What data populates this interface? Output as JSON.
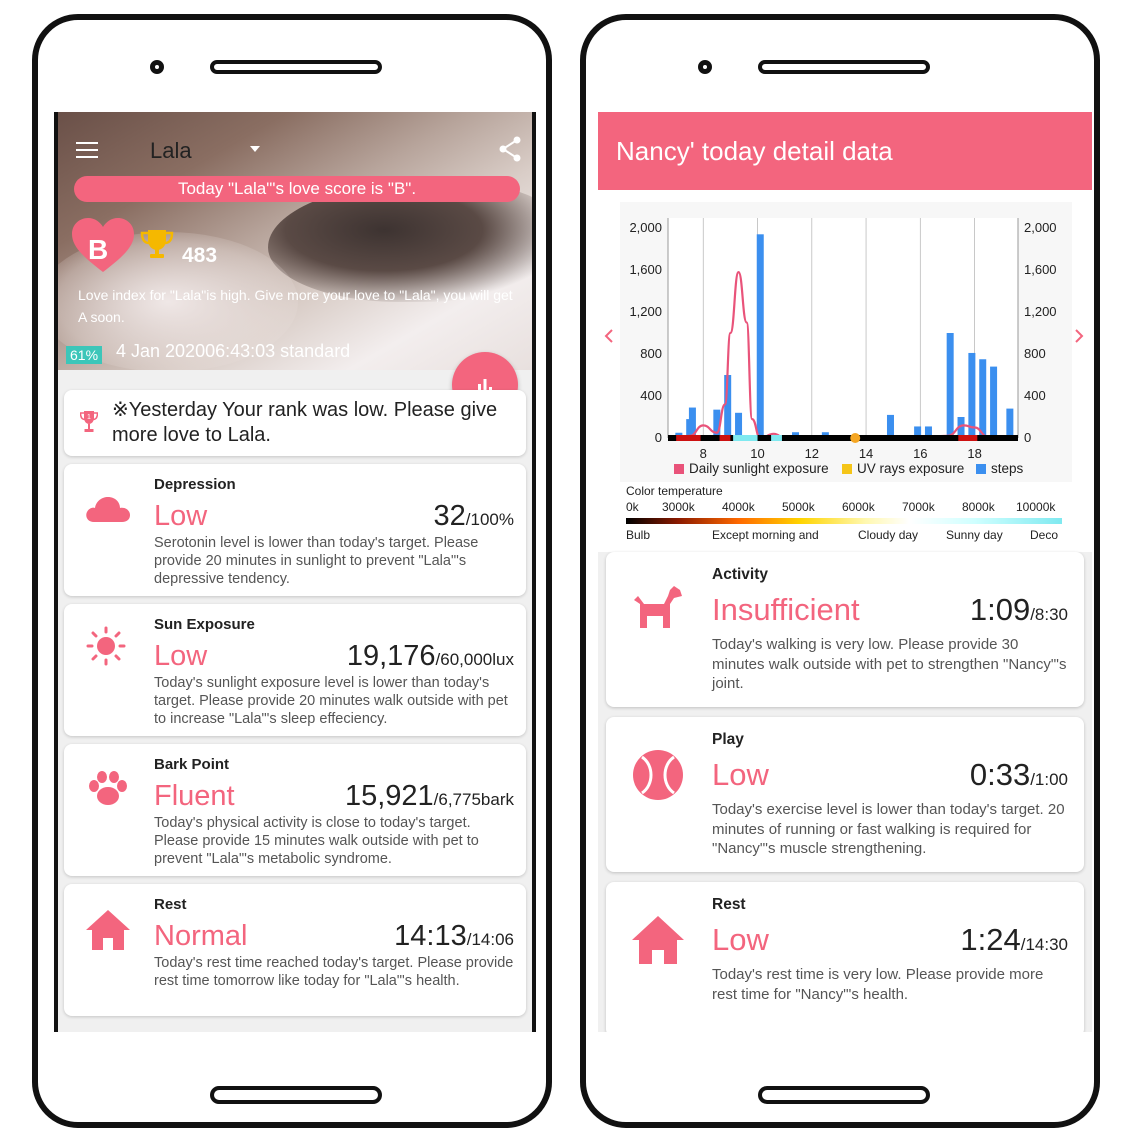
{
  "left": {
    "pet_name": "Lala",
    "score_banner": "Today \"Lala\"'s love score is \"B\".",
    "grade": "B",
    "points": "483",
    "love_message": "Love index for \"Lala\"is high. Give more your love to \"Lala\", you will get A soon.",
    "percent_badge": "61%",
    "timestamp": "4 Jan 202006:43:03 standard",
    "rank_message": "※Yesterday Your rank was low. Please give more love to Lala.",
    "cards": [
      {
        "title": "Depression",
        "level": "Low",
        "value": "32",
        "unit": "/100%",
        "desc": "Serotonin level is lower than today's target. Please provide 20 minutes in sunlight to prevent \"Lala\"'s depressive tendency.",
        "icon": "cloud-icon"
      },
      {
        "title": "Sun Exposure",
        "level": "Low",
        "value": "19,176",
        "unit": "/60,000lux",
        "desc": "Today's sunlight exposure level is lower than today's target. Please provide 20 minutes walk outside with pet to increase \"Lala\"'s sleep effeciency.",
        "icon": "sun-icon"
      },
      {
        "title": "Bark Point",
        "level": "Fluent",
        "value": "15,921",
        "unit": "/6,775bark",
        "desc": "Today's physical activity is close to today's target. Please provide 15 minutes walk outside with pet to prevent \"Lala\"'s metabolic syndrome.",
        "icon": "paw-icon"
      },
      {
        "title": "Rest",
        "level": "Normal",
        "value": "14:13",
        "unit": "/14:06",
        "desc": "Today's rest time reached today's target. Please provide rest time tomorrow like today for \"Lala\"'s health.",
        "icon": "home-icon"
      }
    ]
  },
  "right": {
    "title": "Nancy' today detail data",
    "color_temperature": {
      "title": "Color temperature",
      "scale": [
        "0k",
        "3000k",
        "4000k",
        "5000k",
        "6000k",
        "7000k",
        "8000k",
        "10000k"
      ],
      "labels": [
        "Bulb",
        "Except morning and",
        "Cloudy day",
        "Sunny day",
        "Deco"
      ]
    },
    "cards": [
      {
        "title": "Activity",
        "level": "Insufficient",
        "value": "1:09",
        "unit": "/8:30",
        "desc": "Today's walking is very low. Please provide 30 minutes walk outside with pet to strengthen \"Nancy\"'s joint.",
        "icon": "dog-icon"
      },
      {
        "title": "Play",
        "level": "Low",
        "value": "0:33",
        "unit": "/1:00",
        "desc": "Today's exercise level is lower than today's target. 20 minutes of running or fast walking is required for \"Nancy\"'s muscle strengthening.",
        "icon": "ball-icon"
      },
      {
        "title": "Rest",
        "level": "Low",
        "value": "1:24",
        "unit": "/14:30",
        "desc": "Today's rest time is very low. Please provide more rest time for \"Nancy\"'s health.",
        "icon": "home-icon"
      }
    ]
  },
  "chart_data": {
    "type": "bar",
    "x_ticks": [
      "8",
      "10",
      "12",
      "14",
      "16",
      "18"
    ],
    "xlim": [
      6.7,
      19.6
    ],
    "ylim": [
      0,
      2000
    ],
    "y_ticks_left": [
      "2,000",
      "1,600",
      "1,200",
      "800",
      "400",
      "0"
    ],
    "y_ticks_right": [
      "2,000",
      "1,600",
      "1,200",
      "800",
      "400",
      "0"
    ],
    "grid": "vertical",
    "legend_placement": "bottom",
    "series": [
      {
        "name": "Daily sunlight exposure",
        "type": "line",
        "color": "#e9537a",
        "x": [
          7.0,
          7.5,
          8.0,
          8.5,
          8.8,
          9.0,
          9.3,
          9.6,
          9.8,
          10.1,
          10.6,
          11.0,
          16.0,
          17.0,
          17.6,
          18.0,
          18.5,
          19.0
        ],
        "y": [
          0,
          20,
          120,
          50,
          320,
          1000,
          1580,
          1100,
          180,
          0,
          40,
          0,
          0,
          20,
          120,
          100,
          10,
          0
        ]
      },
      {
        "name": "UV rays exposure",
        "type": "marker",
        "color": "#f5c518",
        "x": [
          13.6
        ],
        "y": [
          0
        ]
      },
      {
        "name": "steps",
        "type": "bar",
        "color": "#3b8fef",
        "x": [
          7.1,
          7.5,
          7.6,
          8.5,
          8.9,
          9.3,
          10.1,
          11.4,
          12.5,
          14.9,
          15.9,
          16.3,
          17.1,
          17.5,
          17.9,
          18.3,
          18.7,
          19.3
        ],
        "y": [
          50,
          180,
          290,
          270,
          600,
          240,
          1940,
          55,
          55,
          220,
          110,
          110,
          1000,
          200,
          810,
          750,
          680,
          280
        ]
      }
    ],
    "timeline_colors": [
      "#cc1111",
      "#000000",
      "#7fe9f0",
      "#f5a623"
    ]
  }
}
